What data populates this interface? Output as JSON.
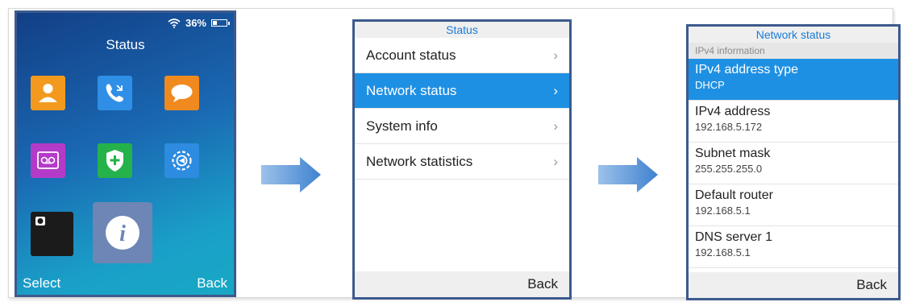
{
  "screen1": {
    "status": {
      "battery_percent": "36%",
      "battery_level": 0.36
    },
    "title": "Status",
    "apps": [
      {
        "name": "contacts-icon",
        "color": "#f39a1e"
      },
      {
        "name": "call-history-icon",
        "color": "#2f8fe6"
      },
      {
        "name": "messages-icon",
        "color": "#f08a1f"
      },
      {
        "name": "voicemail-icon",
        "color": "#b43bc8"
      },
      {
        "name": "security-icon",
        "color": "#25b24a"
      },
      {
        "name": "settings-icon",
        "color": "#2d8be0"
      },
      {
        "name": "camera-icon",
        "color": "#1b1b1b"
      },
      {
        "name": "info-icon",
        "color": "#6d86b5"
      }
    ],
    "softkey_left": "Select",
    "softkey_right": "Back"
  },
  "screen2": {
    "title": "Status",
    "items": [
      {
        "label": "Account status",
        "selected": false
      },
      {
        "label": "Network status",
        "selected": true
      },
      {
        "label": "System info",
        "selected": false
      },
      {
        "label": "Network statistics",
        "selected": false
      }
    ],
    "softkey_right": "Back"
  },
  "screen3": {
    "title": "Network status",
    "section": "IPv4 information",
    "items": [
      {
        "label": "IPv4 address type",
        "value": "DHCP",
        "selected": true
      },
      {
        "label": "IPv4 address",
        "value": "192.168.5.172",
        "selected": false
      },
      {
        "label": "Subnet mask",
        "value": "255.255.255.0",
        "selected": false
      },
      {
        "label": "Default router",
        "value": "192.168.5.1",
        "selected": false
      },
      {
        "label": "DNS server 1",
        "value": "192.168.5.1",
        "selected": false
      }
    ],
    "softkey_right": "Back"
  }
}
